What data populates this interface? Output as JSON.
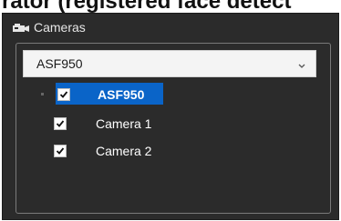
{
  "clipped_heading": "rator (registered face detect",
  "window": {
    "title": "Cameras",
    "title_icon": "camera-group-icon"
  },
  "device_select": {
    "selected": "ASF950"
  },
  "tree": {
    "root": {
      "label": "ASF950",
      "checked": true,
      "selected": true
    },
    "children": [
      {
        "label": "Camera 1",
        "checked": true
      },
      {
        "label": "Camera 2",
        "checked": true
      }
    ]
  },
  "colors": {
    "panel_bg": "#2b2b2b",
    "selection": "#0a64c8",
    "text": "#ffffff"
  }
}
